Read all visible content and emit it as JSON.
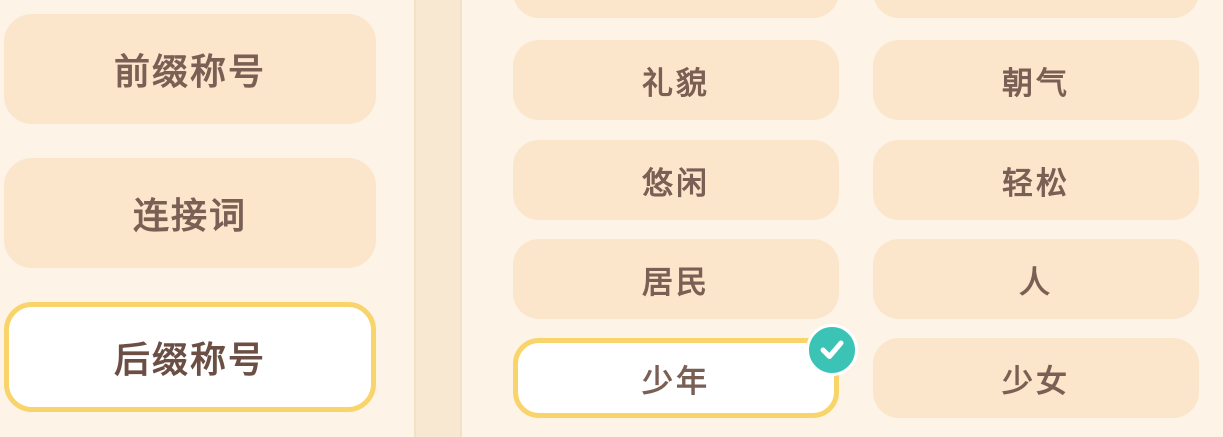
{
  "categories": [
    {
      "label": "前缀称号",
      "selected": false
    },
    {
      "label": "连接词",
      "selected": false
    },
    {
      "label": "后缀称号",
      "selected": true
    }
  ],
  "words": [
    {
      "label": "礼貌"
    },
    {
      "label": "朝气"
    },
    {
      "label": "悠闲"
    },
    {
      "label": "轻松"
    },
    {
      "label": "居民"
    },
    {
      "label": "人"
    },
    {
      "label": "少年",
      "selected": true
    },
    {
      "label": "少女"
    }
  ],
  "colors": {
    "background": "#fdf3e6",
    "button_fill": "#fbe5cb",
    "text": "#7a5f55",
    "selected_border": "#f8d46a",
    "check_badge": "#3bc4b5"
  }
}
